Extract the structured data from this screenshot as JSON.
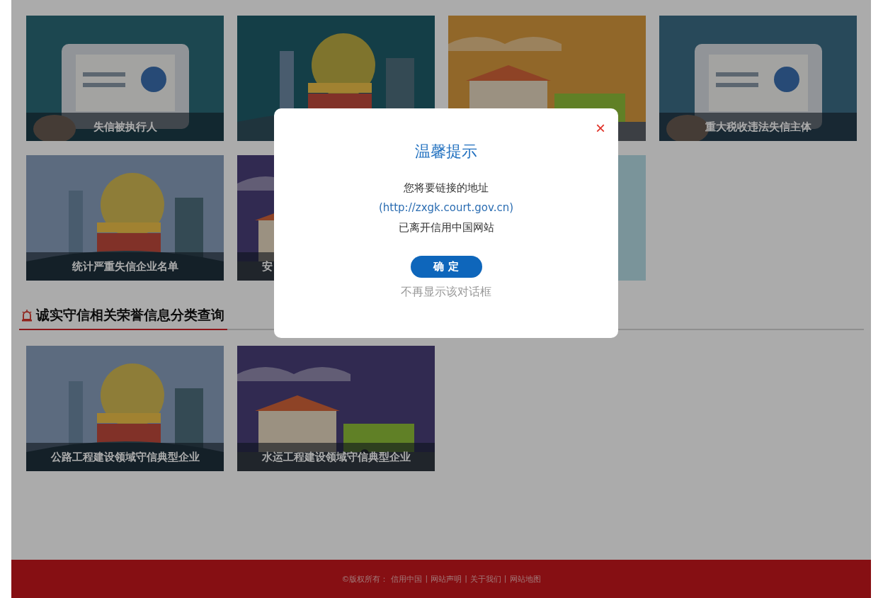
{
  "sections": [
    {
      "cards": [
        {
          "title": "失信被执行人",
          "kind": "picture"
        },
        {
          "kind": "picture"
        },
        {
          "kind": "picture"
        },
        {
          "title": "重大税收违法失信主体",
          "kind": "picture"
        },
        {
          "title": "统计严重失信企业名单",
          "kind": "picture"
        },
        {
          "title": "安",
          "kind": "picture"
        },
        {
          "kind": "picture"
        }
      ]
    },
    {
      "heading": "诚实守信相关荣誉信息分类查询",
      "cards": [
        {
          "title": "公路工程建设领域守信典型企业",
          "kind": "picture"
        },
        {
          "title": "水运工程建设领域守信典型企业",
          "kind": "picture"
        }
      ]
    }
  ],
  "footer": {
    "prefix": "©版权所有：",
    "links": [
      {
        "label": "信用中国"
      },
      {
        "separator": "|",
        "label": "网站声明"
      },
      {
        "separator": "|",
        "label": "关于我们"
      },
      {
        "separator": "|",
        "label": "网站地图"
      }
    ]
  },
  "dialog": {
    "close": "×",
    "title": "温馨提示",
    "line_1": "您将要链接的地址",
    "link": "(http://zxgk.court.gov.cn)",
    "line_2": "已离开信用中国网站",
    "confirm": "确 定",
    "dismiss": "不再显示该对话框"
  }
}
